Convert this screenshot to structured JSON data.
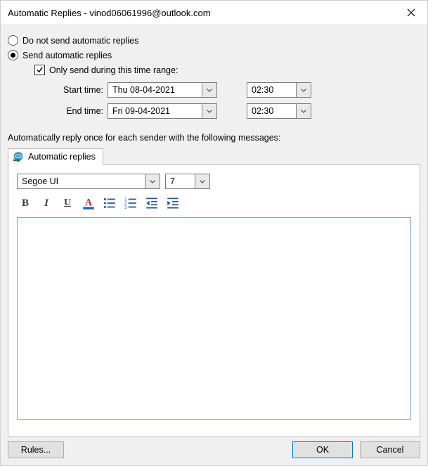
{
  "title": "Automatic Replies - vinod06061996@outlook.com",
  "options": {
    "do_not_send": "Do not send automatic replies",
    "send": "Send automatic replies",
    "only_range": "Only send during this time range:"
  },
  "range": {
    "start_label": "Start time:",
    "start_date": "Thu 08-04-2021",
    "start_time": "02:30",
    "end_label": "End time:",
    "end_date": "Fri 09-04-2021",
    "end_time": "02:30"
  },
  "description": "Automatically reply once for each sender with the following messages:",
  "tab": {
    "label": "Automatic replies"
  },
  "format": {
    "font": "Segoe UI",
    "size": "7"
  },
  "editor_value": "",
  "buttons": {
    "rules": "Rules...",
    "ok": "OK",
    "cancel": "Cancel"
  }
}
